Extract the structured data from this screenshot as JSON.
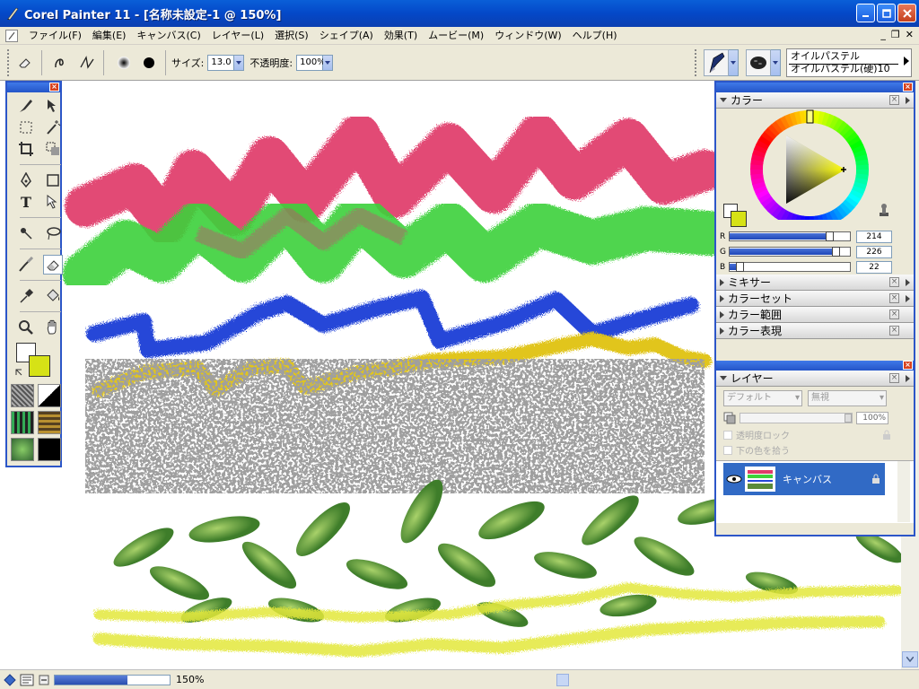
{
  "window": {
    "title": "Corel Painter 11 - [名称未設定-1 @ 150%]"
  },
  "menu": {
    "items": [
      "ファイル(F)",
      "編集(E)",
      "キャンバス(C)",
      "レイヤー(L)",
      "選択(S)",
      "シェイプ(A)",
      "効果(T)",
      "ムービー(M)",
      "ウィンドウ(W)",
      "ヘルプ(H)"
    ]
  },
  "propbar": {
    "size_label": "サイズ:",
    "size_value": "13.0",
    "opacity_label": "不透明度:",
    "opacity_value": "100%",
    "brush_category": "オイルパステル",
    "brush_variant": "オイルパステル(硬)10"
  },
  "status": {
    "zoom": "150%",
    "zoom_fraction": 0.63
  },
  "color_panel": {
    "title": "カラー",
    "r_label": "R",
    "g_label": "G",
    "b_label": "B",
    "r": "214",
    "g": "226",
    "b": "22",
    "main_color": "#d6e216",
    "sub_color": "#ffffff"
  },
  "collapsed_panels": [
    "ミキサー",
    "カラーセット",
    "カラー範囲",
    "カラー表現"
  ],
  "layers_panel": {
    "title": "レイヤー",
    "composite_method": "デフォルト",
    "composite_depth": "無視",
    "opacity": "100%",
    "preserve_transparency": "透明度ロック",
    "pick_underlying": "下の色を拾う",
    "layer_name": "キャンバス"
  }
}
